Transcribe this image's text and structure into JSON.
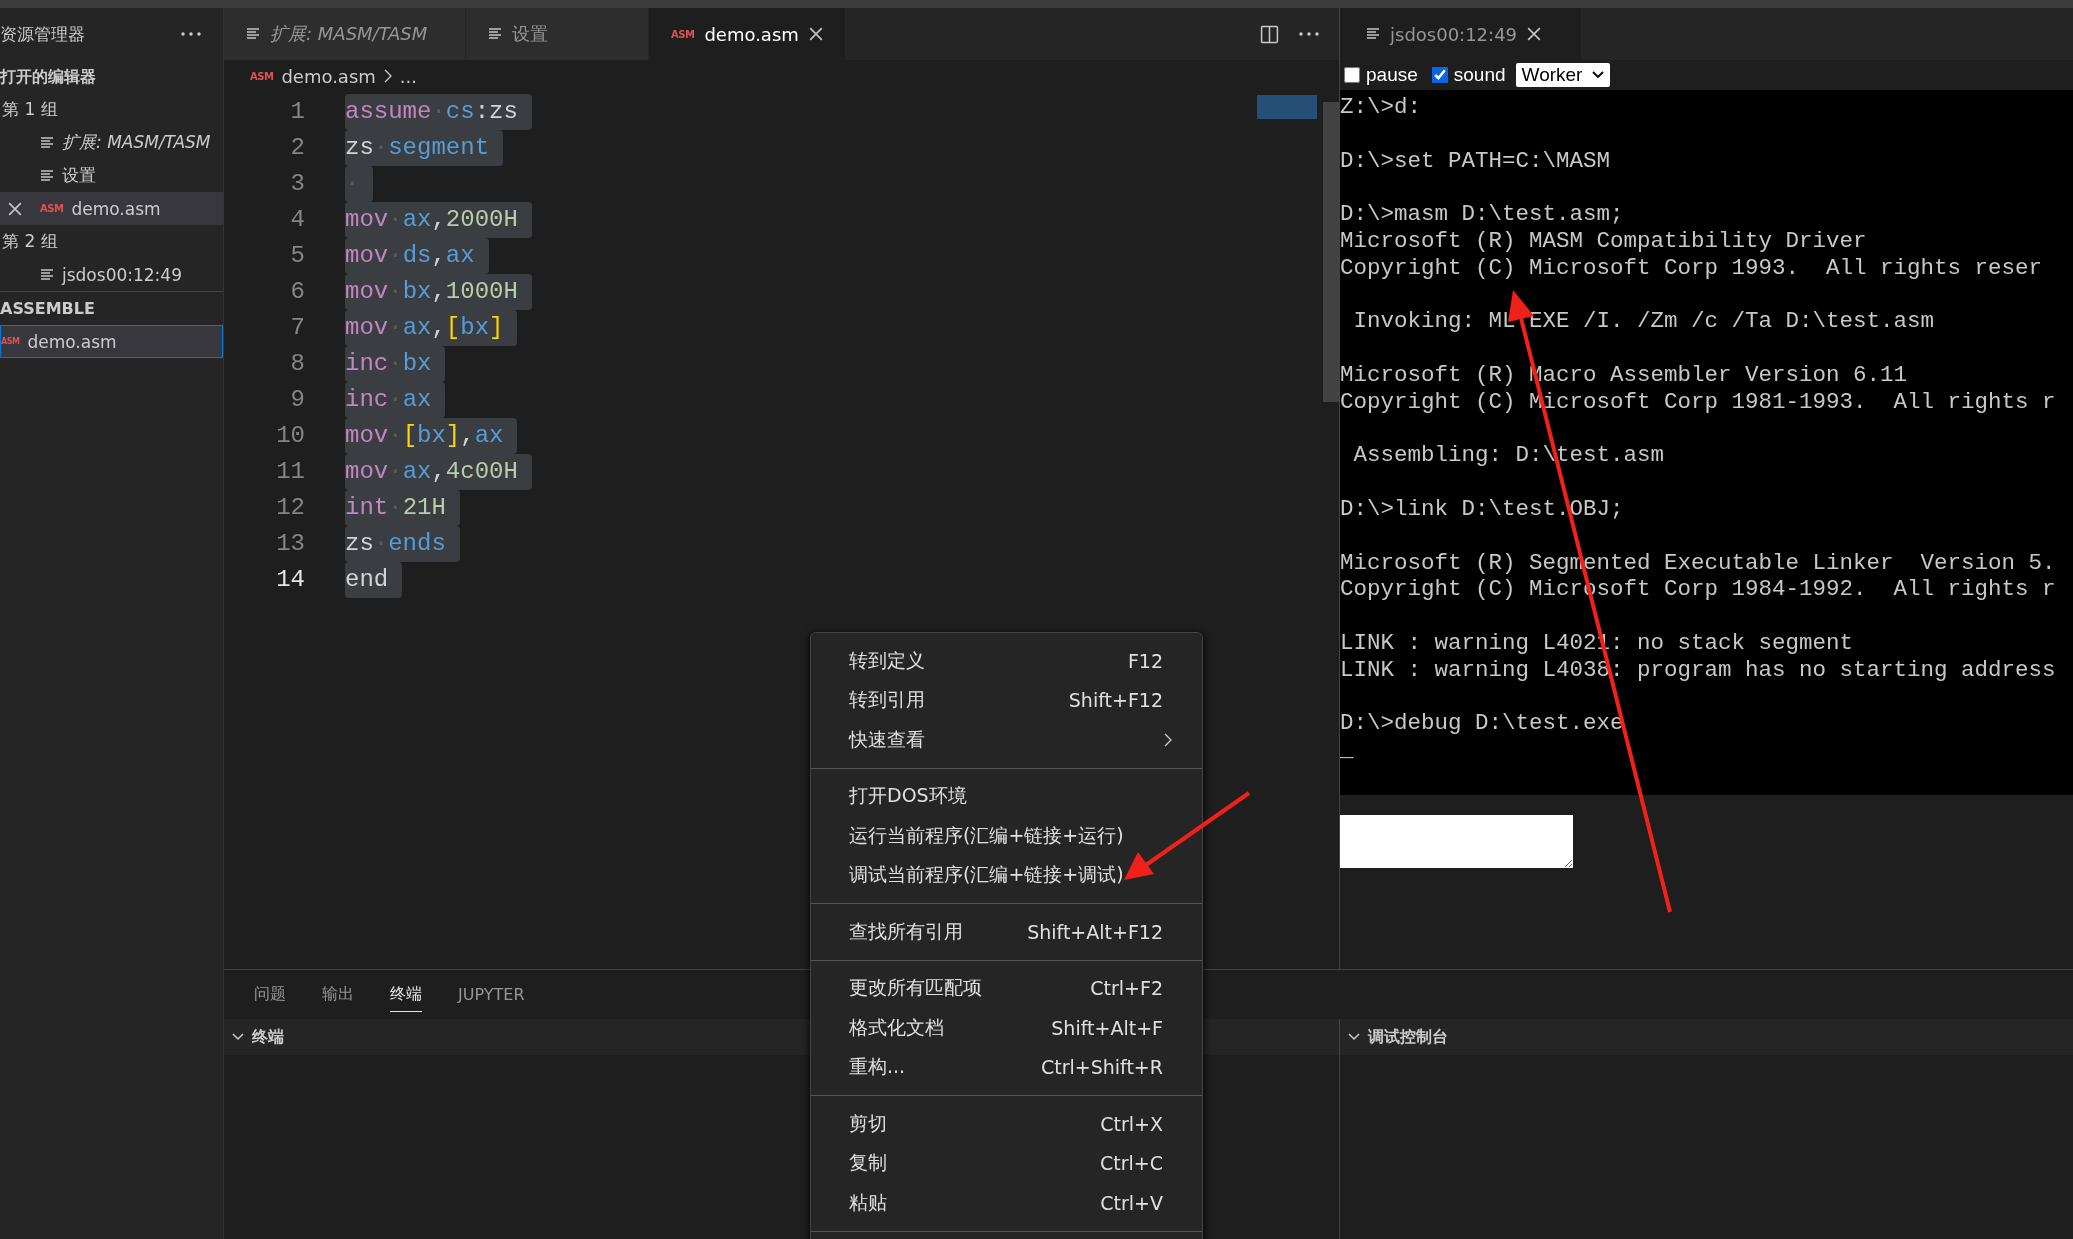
{
  "sidebar": {
    "title": "资源管理器",
    "open_editors": {
      "title": "打开的编辑器",
      "groups": [
        {
          "label": "第 1 组",
          "items": [
            {
              "name": "扩展: MASM/TASM",
              "icon": {
                "kind": "doc"
              },
              "preview": true,
              "selected": false,
              "close": false
            },
            {
              "name": "设置",
              "icon": {
                "kind": "doc"
              },
              "preview": false,
              "selected": false,
              "close": false
            },
            {
              "name": "demo.asm",
              "icon": {
                "kind": "asm",
                "badge": "ASM"
              },
              "preview": false,
              "selected": true,
              "close": true
            }
          ]
        },
        {
          "label": "第 2 组",
          "items": [
            {
              "name": "jsdos00:12:49",
              "icon": {
                "kind": "doc"
              },
              "preview": false,
              "selected": false,
              "close": false
            }
          ]
        }
      ]
    },
    "assemble": {
      "title": "ASSEMBLE",
      "files": [
        {
          "name": "demo.asm",
          "badge": "ASM",
          "selected": true
        }
      ]
    }
  },
  "editor": {
    "tabs": [
      {
        "label": "扩展: MASM/TASM",
        "icon": {
          "kind": "doc"
        },
        "preview": true,
        "selected": false,
        "close": false
      },
      {
        "label": "设置",
        "icon": {
          "kind": "doc"
        },
        "preview": false,
        "selected": false,
        "close": false
      },
      {
        "label": "demo.asm",
        "icon": {
          "kind": "asm",
          "badge": "ASM"
        },
        "preview": false,
        "selected": true,
        "close": true
      }
    ],
    "breadcrumb": {
      "badge": "ASM",
      "file": "demo.asm",
      "rest": "..."
    },
    "lines": [
      {
        "number": "1",
        "current": false,
        "tokens": [
          {
            "t": "assume",
            "kind": "kw"
          },
          {
            "t": "·",
            "kind": "ws"
          },
          {
            "t": "cs",
            "kind": "reg"
          },
          {
            "t": ":zs",
            "kind": "plain"
          }
        ]
      },
      {
        "number": "2",
        "current": false,
        "tokens": [
          {
            "t": "zs",
            "kind": "plain"
          },
          {
            "t": "·",
            "kind": "ws"
          },
          {
            "t": "segment",
            "kind": "reg"
          }
        ]
      },
      {
        "number": "3",
        "current": false,
        "tokens": [
          {
            "t": "·",
            "kind": "ws"
          }
        ]
      },
      {
        "number": "4",
        "current": false,
        "tokens": [
          {
            "t": "mov",
            "kind": "kw"
          },
          {
            "t": "·",
            "kind": "ws"
          },
          {
            "t": "ax",
            "kind": "reg"
          },
          {
            "t": ",",
            "kind": "plain"
          },
          {
            "t": "2000H",
            "kind": "num"
          }
        ]
      },
      {
        "number": "5",
        "current": false,
        "tokens": [
          {
            "t": "mov",
            "kind": "kw"
          },
          {
            "t": "·",
            "kind": "ws"
          },
          {
            "t": "ds",
            "kind": "reg"
          },
          {
            "t": ",",
            "kind": "plain"
          },
          {
            "t": "ax",
            "kind": "reg"
          }
        ]
      },
      {
        "number": "6",
        "current": false,
        "tokens": [
          {
            "t": "mov",
            "kind": "kw"
          },
          {
            "t": "·",
            "kind": "ws"
          },
          {
            "t": "bx",
            "kind": "reg"
          },
          {
            "t": ",",
            "kind": "plain"
          },
          {
            "t": "1000H",
            "kind": "num"
          }
        ]
      },
      {
        "number": "7",
        "current": false,
        "tokens": [
          {
            "t": "mov",
            "kind": "kw"
          },
          {
            "t": "·",
            "kind": "ws"
          },
          {
            "t": "ax",
            "kind": "reg"
          },
          {
            "t": ",",
            "kind": "plain"
          },
          {
            "t": "[",
            "kind": "br"
          },
          {
            "t": "bx",
            "kind": "reg"
          },
          {
            "t": "]",
            "kind": "br"
          }
        ]
      },
      {
        "number": "8",
        "current": false,
        "tokens": [
          {
            "t": "inc",
            "kind": "kw"
          },
          {
            "t": "·",
            "kind": "ws"
          },
          {
            "t": "bx",
            "kind": "reg"
          }
        ]
      },
      {
        "number": "9",
        "current": false,
        "tokens": [
          {
            "t": "inc",
            "kind": "kw"
          },
          {
            "t": "·",
            "kind": "ws"
          },
          {
            "t": "ax",
            "kind": "reg"
          }
        ]
      },
      {
        "number": "10",
        "current": false,
        "tokens": [
          {
            "t": "mov",
            "kind": "kw"
          },
          {
            "t": "·",
            "kind": "ws"
          },
          {
            "t": "[",
            "kind": "br"
          },
          {
            "t": "bx",
            "kind": "reg"
          },
          {
            "t": "]",
            "kind": "br"
          },
          {
            "t": ",",
            "kind": "plain"
          },
          {
            "t": "ax",
            "kind": "reg"
          }
        ]
      },
      {
        "number": "11",
        "current": false,
        "tokens": [
          {
            "t": "mov",
            "kind": "kw"
          },
          {
            "t": "·",
            "kind": "ws"
          },
          {
            "t": "ax",
            "kind": "reg"
          },
          {
            "t": ",",
            "kind": "plain"
          },
          {
            "t": "4c00H",
            "kind": "num"
          }
        ]
      },
      {
        "number": "12",
        "current": false,
        "tokens": [
          {
            "t": "int",
            "kind": "kw"
          },
          {
            "t": "·",
            "kind": "ws"
          },
          {
            "t": "21H",
            "kind": "num"
          }
        ]
      },
      {
        "number": "13",
        "current": false,
        "tokens": [
          {
            "t": "zs",
            "kind": "plain"
          },
          {
            "t": "·",
            "kind": "ws"
          },
          {
            "t": "ends",
            "kind": "reg"
          }
        ]
      },
      {
        "number": "14",
        "current": true,
        "tokens": [
          {
            "t": "end",
            "kind": "plain"
          }
        ]
      }
    ]
  },
  "dos": {
    "tab": {
      "label": "jsdos00:12:49",
      "close": true
    },
    "pause": {
      "label": "pause",
      "checked": false
    },
    "sound": {
      "label": "sound",
      "checked": true
    },
    "worker_select": {
      "value": "Worker"
    },
    "terminal_blocks": [
      [
        "Z:\\>d:"
      ],
      [
        "D:\\>set PATH=C:\\MASM"
      ],
      [
        "D:\\>masm D:\\test.asm;",
        "Microsoft (R) MASM Compatibility Driver",
        "Copyright (C) Microsoft Corp 1993.  All rights reser"
      ],
      [
        " Invoking: ML.EXE /I. /Zm /c /Ta D:\\test.asm"
      ],
      [
        "Microsoft (R) Macro Assembler Version 6.11",
        "Copyright (C) Microsoft Corp 1981-1993.  All rights r"
      ],
      [
        " Assembling: D:\\test.asm"
      ],
      [
        "D:\\>link D:\\test.OBJ;"
      ],
      [
        "Microsoft (R) Segmented Executable Linker  Version 5.",
        "Copyright (C) Microsoft Corp 1984-1992.  All rights r"
      ],
      [
        "LINK : warning L4021: no stack segment",
        "LINK : warning L4038: program has no starting address"
      ],
      [
        "D:\\>debug D:\\test.exe",
        "_"
      ]
    ]
  },
  "panel": {
    "tabs": [
      {
        "label": "问题",
        "selected": false
      },
      {
        "label": "输出",
        "selected": false
      },
      {
        "label": "终端",
        "selected": true
      },
      {
        "label": "JUPYTER",
        "selected": false
      }
    ],
    "terminal_section": {
      "title": "终端",
      "expanded": true
    },
    "debug_section": {
      "title": "调试控制台",
      "expanded": true
    }
  },
  "context_menu": {
    "groups": [
      [
        {
          "label": "转到定义",
          "shortcut": "F12",
          "submenu": false
        },
        {
          "label": "转到引用",
          "shortcut": "Shift+F12",
          "submenu": false
        },
        {
          "label": "快速查看",
          "submenu": true
        }
      ],
      [
        {
          "label": "打开DOS环境",
          "submenu": false
        },
        {
          "label": "运行当前程序(汇编+链接+运行)",
          "submenu": false
        },
        {
          "label": "调试当前程序(汇编+链接+调试)",
          "submenu": false
        }
      ],
      [
        {
          "label": "查找所有引用",
          "shortcut": "Shift+Alt+F12",
          "submenu": false
        }
      ],
      [
        {
          "label": "更改所有匹配项",
          "shortcut": "Ctrl+F2",
          "submenu": false
        },
        {
          "label": "格式化文档",
          "shortcut": "Shift+Alt+F",
          "submenu": false
        },
        {
          "label": "重构...",
          "shortcut": "Ctrl+Shift+R",
          "submenu": false
        }
      ],
      [
        {
          "label": "剪切",
          "shortcut": "Ctrl+X",
          "submenu": false
        },
        {
          "label": "复制",
          "shortcut": "Ctrl+C",
          "submenu": false
        },
        {
          "label": "粘贴",
          "shortcut": "Ctrl+V",
          "submenu": false
        }
      ]
    ]
  }
}
